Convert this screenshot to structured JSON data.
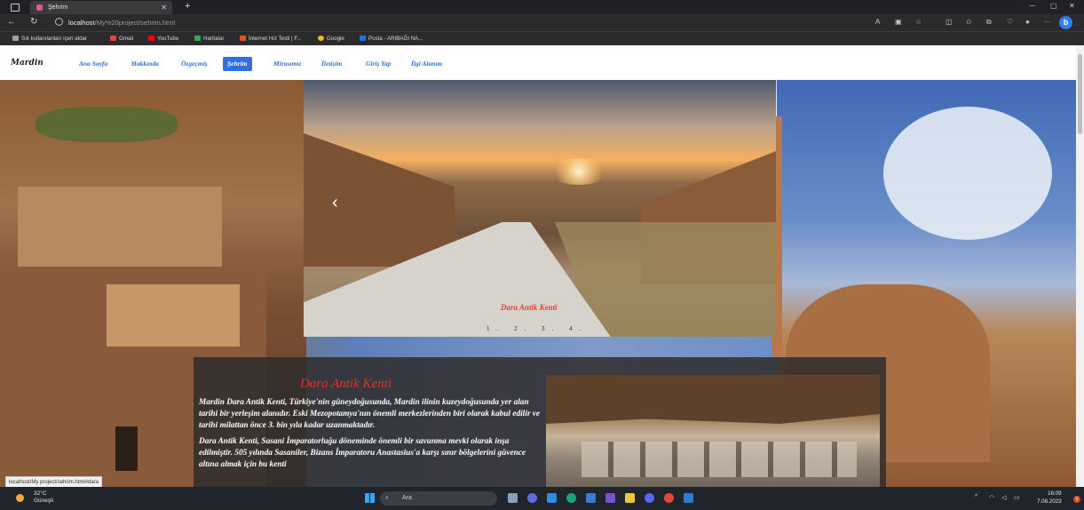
{
  "browser": {
    "tab_title": "Şehrim",
    "url_host": "localhost",
    "url_path": "/My%20project/sehrim.html",
    "status_url": "localhost/My project/sehrim.html#dara"
  },
  "bookmarks": [
    {
      "label": "Sık kullanılanları içeri aktar",
      "color": "#9aa0a6"
    },
    {
      "label": "Gmail",
      "color": "#ea4335"
    },
    {
      "label": "YouTube",
      "color": "#ff0000"
    },
    {
      "label": "Haritalar",
      "color": "#34a853"
    },
    {
      "label": "İnternet Hız Testi | F...",
      "color": "#e0542c"
    },
    {
      "label": "Google",
      "color": "#fbbc05"
    },
    {
      "label": "Posta - ARIBAĞI NA...",
      "color": "#1a73e8"
    }
  ],
  "site": {
    "logo": "Mardin",
    "nav": [
      {
        "label": "Ana Sayfa",
        "active": false
      },
      {
        "label": "Hakkında",
        "active": false
      },
      {
        "label": "Özgeçmiş",
        "active": false
      },
      {
        "label": "Şehrim",
        "active": true
      },
      {
        "label": "Mirasımız",
        "active": false
      },
      {
        "label": "İletişim",
        "active": false
      },
      {
        "label": "Giriş Yap",
        "active": false
      },
      {
        "label": "İlgi Alanım",
        "active": false
      }
    ],
    "carousel": {
      "caption": "Dara Antik Kenti",
      "indicators": "1. 2. 3. 4.",
      "prev": "‹"
    },
    "article": {
      "title": "Dara Antik Kenti",
      "paragraphs": [
        "Mardin Dara Antik Kenti, Türkiye'nin güneydoğusunda, Mardin ilinin kuzeydoğusunda yer alan tarihi bir yerleşim alanıdır. Eski Mezopotamya'nın önemli merkezlerinden biri olarak kabul edilir ve tarihi milattan önce 3. bin yıla kadar uzanmaktadır.",
        "Dara Antik Kenti, Sasani İmparatorluğu döneminde önemli bir savunma mevki olarak inşa edilmiştir. 505 yılında Sasaniler, Bizans İmparatoru Anastasius'a karşı sınır bölgelerini güvence altına almak için bu kenti"
      ]
    }
  },
  "taskbar": {
    "weather_temp": "32°C",
    "weather_desc": "Güneşli",
    "search_placeholder": "Ara",
    "time": "16:09",
    "date": "7.08.2023",
    "notif_count": "1"
  }
}
